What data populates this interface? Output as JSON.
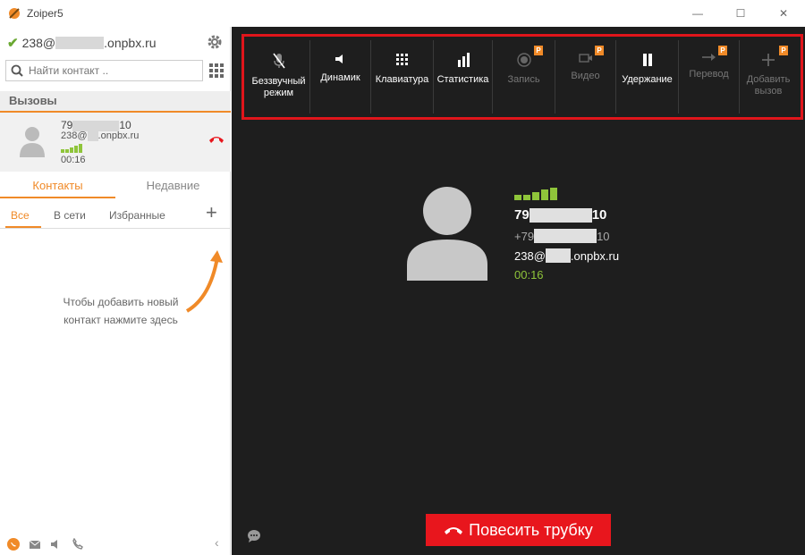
{
  "window": {
    "title": "Zoiper5",
    "minimize": "—",
    "maximize": "☐",
    "close": "✕"
  },
  "account": {
    "prefix": "238@",
    "suffix": ".onpbx.ru"
  },
  "search": {
    "placeholder": "Найти контакт .."
  },
  "calls_section": {
    "title": "Вызовы"
  },
  "active_call": {
    "number_prefix": "79",
    "number_suffix": "10",
    "account_prefix": "238@",
    "account_suffix": ".onpbx.ru",
    "duration": "00:16"
  },
  "contact_tabs": [
    {
      "label": "Контакты",
      "active": true
    },
    {
      "label": "Недавние",
      "active": false
    }
  ],
  "filter_tabs": [
    {
      "label": "Все",
      "active": true
    },
    {
      "label": "В сети",
      "active": false
    },
    {
      "label": "Избранные",
      "active": false
    }
  ],
  "add_contact_hint": "Чтобы добавить новый контакт нажмите здесь",
  "toolbar": [
    {
      "label": "Беззвучный режим",
      "icon": "mic-muted-icon",
      "disabled": false,
      "premium": false
    },
    {
      "label": "Динамик",
      "icon": "speaker-icon",
      "disabled": false,
      "premium": false
    },
    {
      "label": "Клавиатура",
      "icon": "keypad-icon",
      "disabled": false,
      "premium": false
    },
    {
      "label": "Статистика",
      "icon": "stats-icon",
      "disabled": false,
      "premium": false
    },
    {
      "label": "Запись",
      "icon": "record-icon",
      "disabled": true,
      "premium": true,
      "badge": "P"
    },
    {
      "label": "Видео",
      "icon": "video-icon",
      "disabled": true,
      "premium": true,
      "badge": "P"
    },
    {
      "label": "Удержание",
      "icon": "pause-icon",
      "disabled": false,
      "premium": false
    },
    {
      "label": "Перевод",
      "icon": "transfer-icon",
      "disabled": true,
      "premium": true,
      "badge": "P"
    },
    {
      "label": "Добавить вызов",
      "icon": "add-call-icon",
      "disabled": true,
      "premium": true,
      "badge": "P"
    }
  ],
  "peer": {
    "name_prefix": "79",
    "name_suffix": "10",
    "phone_prefix": "+79",
    "phone_suffix": "10",
    "account_prefix": "238@",
    "account_suffix": ".onpbx.ru",
    "duration": "00:16"
  },
  "hangup": {
    "label": "Повесить трубку"
  },
  "colors": {
    "accent": "#f08a28",
    "hangup": "#e8161d",
    "signal": "#8fc53a",
    "main_bg": "#1e1e1e",
    "toolbar_outline": "#e0151b"
  }
}
